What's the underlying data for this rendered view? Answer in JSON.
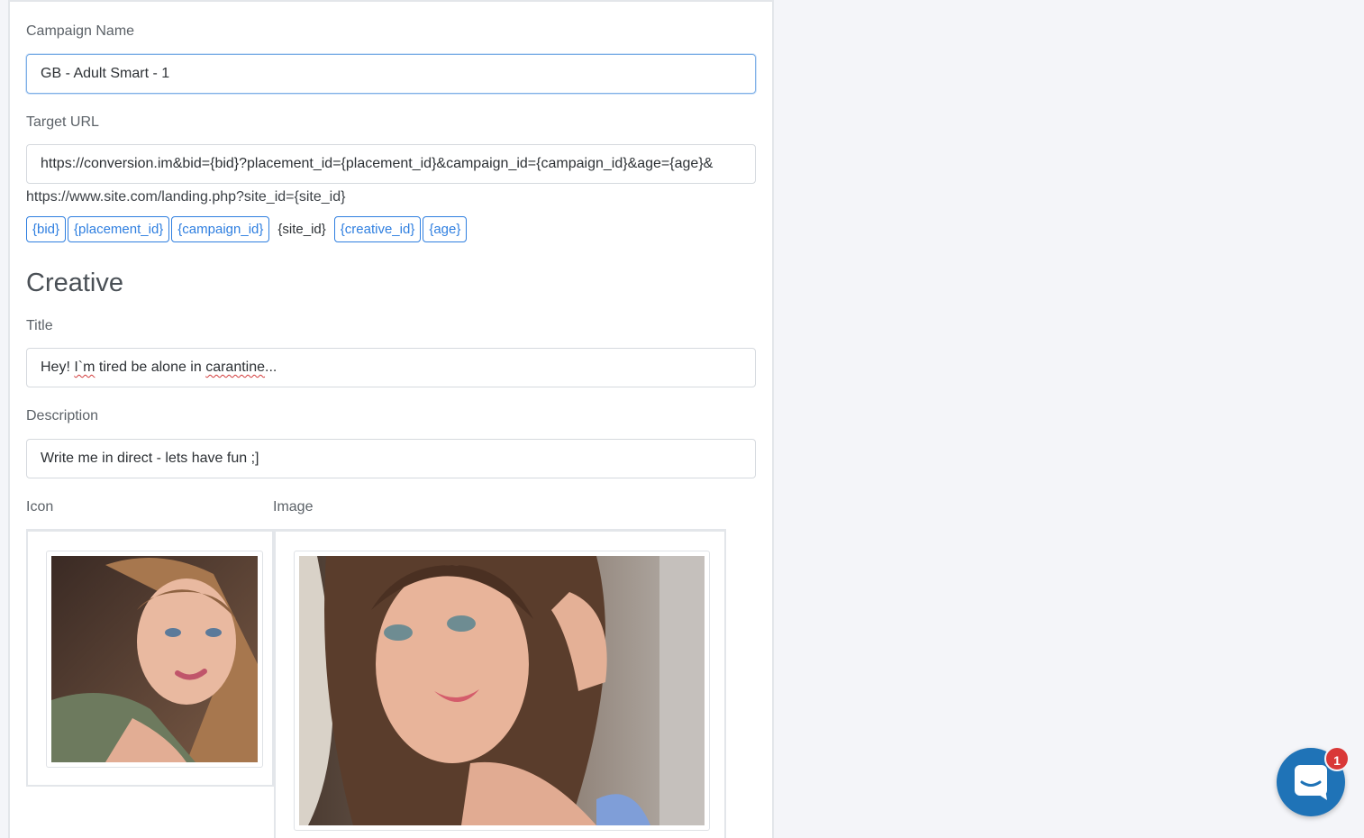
{
  "form": {
    "campaign_name": {
      "label": "Campaign Name",
      "value": "GB - Adult Smart - 1"
    },
    "target_url": {
      "label": "Target URL",
      "value": "https://conversion.im&bid={bid}?placement_id={placement_id}&campaign_id={campaign_id}&age={age}&",
      "example": "https://www.site.com/landing.php?site_id={site_id}"
    },
    "macros": [
      "{bid}",
      "{placement_id}",
      "{campaign_id}",
      "{site_id}",
      "{creative_id}",
      "{age}"
    ]
  },
  "creative": {
    "heading": "Creative",
    "title": {
      "label": "Title",
      "value_parts": [
        "Hey! ",
        "I`m",
        " tired be alone in ",
        "carantine",
        "..."
      ]
    },
    "description": {
      "label": "Description",
      "value": "Write me in direct - lets have fun ;]"
    },
    "icon": {
      "label": "Icon"
    },
    "image": {
      "label": "Image"
    }
  },
  "chat": {
    "icon": "chat-bubble-icon",
    "badge": "1"
  },
  "colors": {
    "accent": "#2f7fe0",
    "chat": "#1f73b7",
    "badge": "#d93838"
  }
}
